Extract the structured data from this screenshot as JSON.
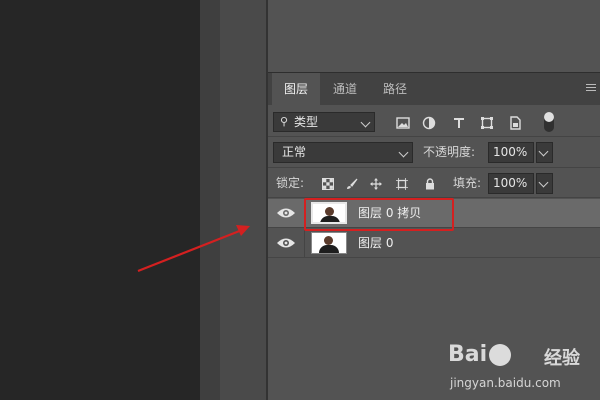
{
  "panel": {
    "tabs": [
      {
        "label": "图层",
        "active": true
      },
      {
        "label": "通道",
        "active": false
      },
      {
        "label": "路径",
        "active": false
      }
    ],
    "filter": {
      "kind_label": "类型"
    },
    "blend_mode": "正常",
    "opacity": {
      "label": "不透明度:",
      "value": "100%"
    },
    "lock": {
      "label": "锁定:"
    },
    "fill": {
      "label": "填充:",
      "value": "100%"
    },
    "layers": [
      {
        "name": "图层 0 拷贝",
        "selected": true,
        "visible": true
      },
      {
        "name": "图层 0",
        "selected": false,
        "visible": true
      }
    ]
  },
  "annotation": {
    "highlight_color": "#d42020",
    "target": "图层 0 拷贝"
  },
  "watermark": {
    "brand": "Bai",
    "brand_tail": "经验",
    "url": "jingyan.baidu.com"
  },
  "colors": {
    "panel_bg": "#535353",
    "selected_row": "#6a6a6a",
    "canvas": "#262626"
  }
}
